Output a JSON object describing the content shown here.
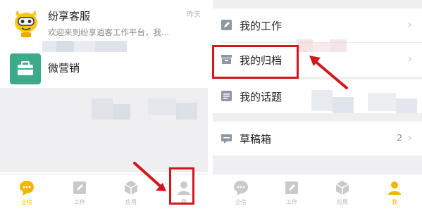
{
  "left_panel": {
    "chats": [
      {
        "title": "纷享客服",
        "preview": "欢迎来到纷享逍客工作平台，我...",
        "time": "昨天"
      },
      {
        "title": "微营销",
        "preview": "",
        "time": ""
      }
    ],
    "tabs": [
      {
        "label": "企信",
        "icon": "chat-bubble-icon"
      },
      {
        "label": "工作",
        "icon": "pencil-icon"
      },
      {
        "label": "应用",
        "icon": "cube-icon"
      },
      {
        "label": "我",
        "icon": "person-icon"
      }
    ],
    "active_tab": "企信"
  },
  "right_panel": {
    "menu": [
      {
        "label": "我的工作",
        "icon": "edit-icon",
        "count": ""
      },
      {
        "label": "我的归档",
        "icon": "archive-icon",
        "count": ""
      },
      {
        "label": "我的话题",
        "icon": "topic-icon",
        "count": ""
      },
      {
        "label": "草稿箱",
        "icon": "drafts-icon",
        "count": "2"
      }
    ],
    "chevron": "›",
    "tabs": [
      {
        "label": "企信",
        "icon": "chat-bubble-icon"
      },
      {
        "label": "工作",
        "icon": "pencil-icon"
      },
      {
        "label": "应用",
        "icon": "cube-icon"
      },
      {
        "label": "我",
        "icon": "person-icon"
      }
    ],
    "active_tab": "我"
  },
  "colors": {
    "accent": "#f3b500",
    "annotation": "#d6141c",
    "app_icon_green": "#3dab8a",
    "background_gray": "#efeff1"
  }
}
